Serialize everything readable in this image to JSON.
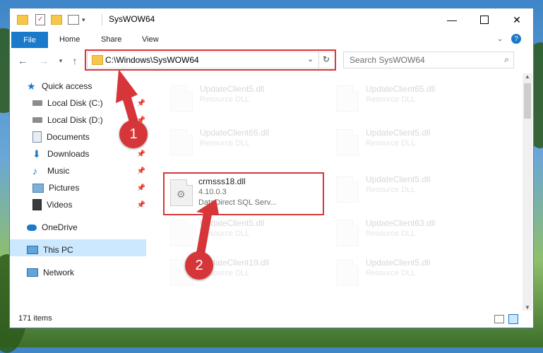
{
  "window": {
    "title": "SysWOW64"
  },
  "ribbon": {
    "file": "File",
    "tabs": [
      "Home",
      "Share",
      "View"
    ]
  },
  "address": {
    "path": "C:\\Windows\\SysWOW64",
    "search_placeholder": "Search SysWOW64"
  },
  "sidebar": {
    "items": [
      {
        "label": "Quick access",
        "icon": "star-icon"
      },
      {
        "label": "Local Disk (C:)",
        "icon": "drive-icon",
        "pinned": true
      },
      {
        "label": "Local Disk (D:)",
        "icon": "drive-icon",
        "pinned": true
      },
      {
        "label": "Documents",
        "icon": "documents-icon",
        "pinned": true
      },
      {
        "label": "Downloads",
        "icon": "download-icon",
        "pinned": true
      },
      {
        "label": "Music",
        "icon": "music-icon",
        "pinned": true
      },
      {
        "label": "Pictures",
        "icon": "pictures-icon",
        "pinned": true
      },
      {
        "label": "Videos",
        "icon": "videos-icon",
        "pinned": true
      },
      {
        "label": "OneDrive",
        "icon": "cloud-icon"
      },
      {
        "label": "This PC",
        "icon": "pc-icon",
        "selected": true
      },
      {
        "label": "Network",
        "icon": "network-icon"
      }
    ]
  },
  "files": {
    "left": [
      {
        "name": "UpdateClient5.dll",
        "desc": "Resource DLL"
      },
      {
        "name": "UpdateClient65.dll",
        "desc": "Resource DLL"
      },
      {
        "name": "crmsss18.dll",
        "version": "4.10.0.3",
        "desc": "DataDirect SQL Serv..."
      },
      {
        "name": "UpdateClient5.dll",
        "desc": "Resource DLL"
      },
      {
        "name": "UpdateClient19.dll",
        "desc": "Resource DLL"
      }
    ],
    "right": [
      {
        "name": "UpdateClient65.dll",
        "desc": "Resource DLL"
      },
      {
        "name": "UpdateClient5.dll",
        "desc": "Resource DLL"
      },
      {
        "name": "UpdateClient5.dll",
        "desc": "Resource DLL"
      },
      {
        "name": "UpdateClient63.dll",
        "desc": "Resource DLL"
      },
      {
        "name": "UpdateClient5.dll",
        "desc": "Resource DLL"
      }
    ]
  },
  "status": {
    "count": "171 items"
  },
  "annotations": {
    "step1": "1",
    "step2": "2"
  },
  "colors": {
    "accent": "#1979ca",
    "highlight": "#d6363a",
    "selected": "#cce8ff"
  }
}
